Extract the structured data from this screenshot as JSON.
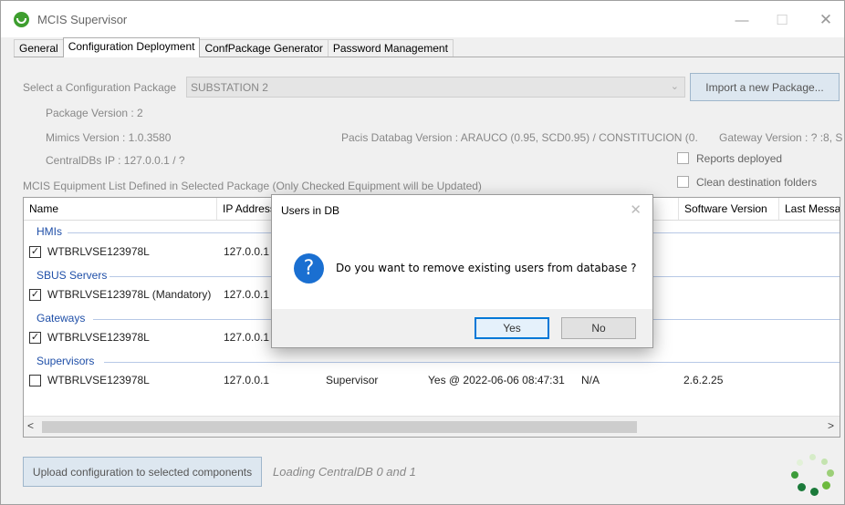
{
  "window": {
    "title": "MCIS Supervisor"
  },
  "tabs": [
    {
      "label": "General",
      "active": false
    },
    {
      "label": "Configuration Deployment",
      "active": true
    },
    {
      "label": "ConfPackage Generator",
      "active": false
    },
    {
      "label": "Password Management",
      "active": false
    }
  ],
  "package": {
    "select_label": "Select a Configuration Package",
    "selected": "SUBSTATION 2",
    "import_button": "Import a new Package...",
    "version": "Package Version : 2",
    "mimics_version": "Mimics Version : 1.0.3580",
    "pacis_version": "Pacis Databag Version : ARAUCO (0.95, SCD0.95) / CONSTITUCION (0.",
    "gateway_version": "Gateway Version : ? :8, S",
    "centraldb_ip": "CentralDBs IP : 127.0.0.1 / ?"
  },
  "options": {
    "reports_deployed": "Reports deployed",
    "clean_destination": "Clean destination folders"
  },
  "equipment_list_label": "MCIS Equipment List Defined in Selected Package (Only Checked Equipment will be Updated)",
  "grid": {
    "columns": [
      "Name",
      "IP Address",
      "",
      "",
      "",
      "Software Version",
      "Last Messa"
    ],
    "groups": [
      {
        "label": "HMIs",
        "rows": [
          {
            "checked": true,
            "name": "WTBRLVSE123978L",
            "ip": "127.0.0.1"
          }
        ]
      },
      {
        "label": "SBUS Servers",
        "rows": [
          {
            "checked": true,
            "name": "WTBRLVSE123978L (Mandatory)",
            "ip": "127.0.0.1"
          }
        ]
      },
      {
        "label": "Gateways",
        "rows": [
          {
            "checked": true,
            "name": "WTBRLVSE123978L",
            "ip": "127.0.0.1"
          }
        ]
      },
      {
        "label": "Supervisors",
        "rows": [
          {
            "checked": false,
            "name": "WTBRLVSE123978L",
            "ip": "127.0.0.1",
            "type": "Supervisor",
            "status": "Yes @ 2022-06-06 08:47:31",
            "extra": "N/A",
            "software_version": "2.6.2.25"
          }
        ]
      }
    ]
  },
  "footer": {
    "upload_button": "Upload configuration to selected components",
    "loading_text": "Loading CentralDB 0 and 1"
  },
  "dialog": {
    "title": "Users in DB",
    "message": "Do you want to remove existing users from database ?",
    "yes": "Yes",
    "no": "No"
  },
  "icons": {
    "app": "mcis-app-icon",
    "question": "question-icon",
    "spinner": "loading-spinner-icon"
  },
  "colors": {
    "accent": "#0078d7",
    "group": "#1f4fa8",
    "app_icon": "#3e9e2f"
  }
}
